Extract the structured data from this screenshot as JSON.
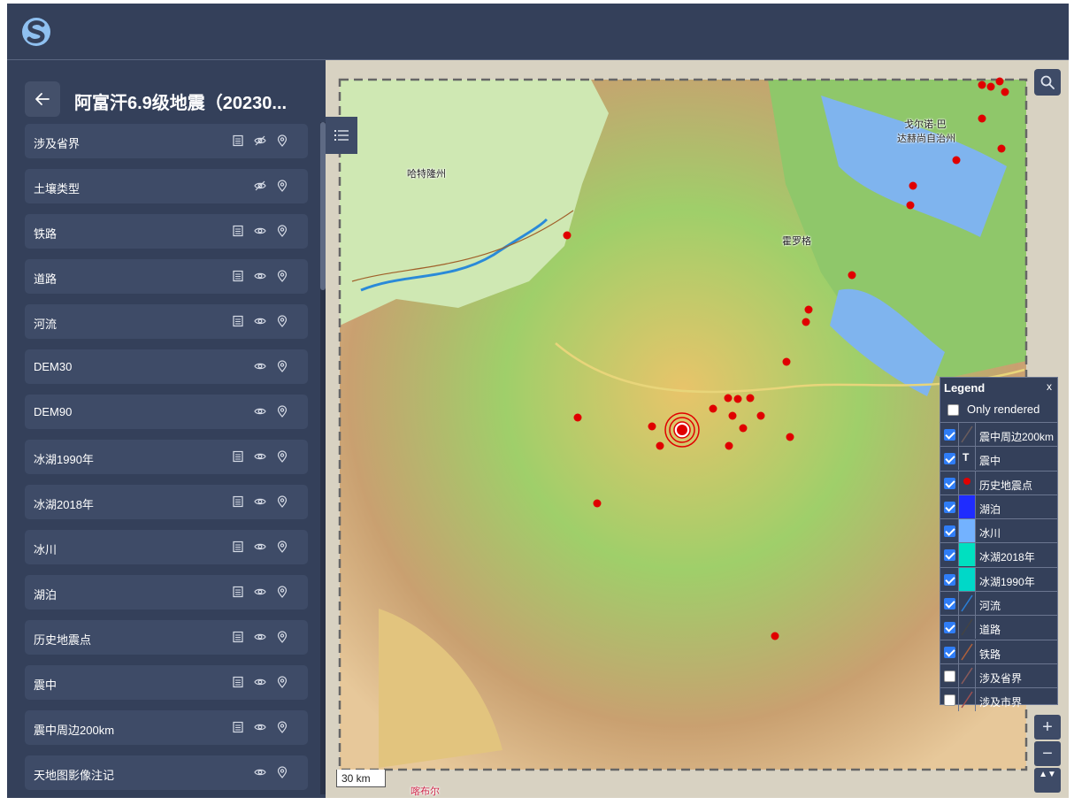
{
  "header": {
    "logo_icon": "s-logo-icon"
  },
  "sidebar": {
    "title": "阿富汗6.9级地震（20230...",
    "layers": [
      {
        "name": "涉及省界",
        "icons": [
          "table",
          "eye-off",
          "locate"
        ]
      },
      {
        "name": "土壤类型",
        "icons": [
          "eye-off",
          "locate"
        ]
      },
      {
        "name": "铁路",
        "icons": [
          "table",
          "eye",
          "locate"
        ]
      },
      {
        "name": "道路",
        "icons": [
          "table",
          "eye",
          "locate"
        ]
      },
      {
        "name": "河流",
        "icons": [
          "table",
          "eye",
          "locate"
        ]
      },
      {
        "name": "DEM30",
        "icons": [
          "eye",
          "locate"
        ]
      },
      {
        "name": "DEM90",
        "icons": [
          "eye",
          "locate"
        ]
      },
      {
        "name": "冰湖1990年",
        "icons": [
          "table",
          "eye",
          "locate"
        ]
      },
      {
        "name": "冰湖2018年",
        "icons": [
          "table",
          "eye",
          "locate"
        ]
      },
      {
        "name": "冰川",
        "icons": [
          "table",
          "eye",
          "locate"
        ]
      },
      {
        "name": "湖泊",
        "icons": [
          "table",
          "eye",
          "locate"
        ]
      },
      {
        "name": "历史地震点",
        "icons": [
          "table",
          "eye",
          "locate"
        ]
      },
      {
        "name": "震中",
        "icons": [
          "table",
          "eye",
          "locate"
        ]
      },
      {
        "name": "震中周边200km",
        "icons": [
          "table",
          "eye",
          "locate"
        ]
      },
      {
        "name": "天地图影像注记",
        "icons": [
          "eye",
          "locate"
        ]
      }
    ]
  },
  "map": {
    "scale_label": "30 km",
    "places": [
      {
        "name": "哈特隆州",
        "style": "normal"
      },
      {
        "name": "戈尔诺-巴",
        "style": "normal"
      },
      {
        "name": "达赫尚自治州",
        "style": "normal"
      },
      {
        "name": "霍罗格",
        "style": "normal"
      },
      {
        "name": "喀布尔",
        "style": "red"
      }
    ],
    "zoom_in": "+",
    "zoom_out": "−",
    "compass": "▲▼"
  },
  "legend": {
    "title": "Legend",
    "close": "x",
    "only_rendered": "Only rendered",
    "only_rendered_checked": false,
    "items": [
      {
        "label": "震中周边200km",
        "checked": true,
        "symbol": "line",
        "color": "#6b5d5d"
      },
      {
        "label": "震中",
        "checked": true,
        "symbol": "text-T",
        "color": "#000000"
      },
      {
        "label": "历史地震点",
        "checked": true,
        "symbol": "dot",
        "color": "#e00000"
      },
      {
        "label": "湖泊",
        "checked": true,
        "symbol": "fill",
        "color": "#1f2cff"
      },
      {
        "label": "冰川",
        "checked": true,
        "symbol": "fill",
        "color": "#73b2ff"
      },
      {
        "label": "冰湖2018年",
        "checked": true,
        "symbol": "fill",
        "color": "#00e0c0"
      },
      {
        "label": "冰湖1990年",
        "checked": true,
        "symbol": "fill",
        "color": "#00d8c8"
      },
      {
        "label": "河流",
        "checked": true,
        "symbol": "line",
        "color": "#2a7fd8"
      },
      {
        "label": "道路",
        "checked": true,
        "symbol": "line",
        "color": "#444444"
      },
      {
        "label": "铁路",
        "checked": true,
        "symbol": "line",
        "color": "#b0603a"
      },
      {
        "label": "涉及省界",
        "checked": false,
        "symbol": "line",
        "color": "#8a5a5a"
      },
      {
        "label": "涉及市界",
        "checked": false,
        "symbol": "line",
        "color": "#a05050"
      }
    ]
  },
  "colors": {
    "panel": "#34405a",
    "item": "#3e4b67",
    "epicenter": "#e00000",
    "lake": "#1f2cff",
    "glacier": "#73b2ff"
  }
}
